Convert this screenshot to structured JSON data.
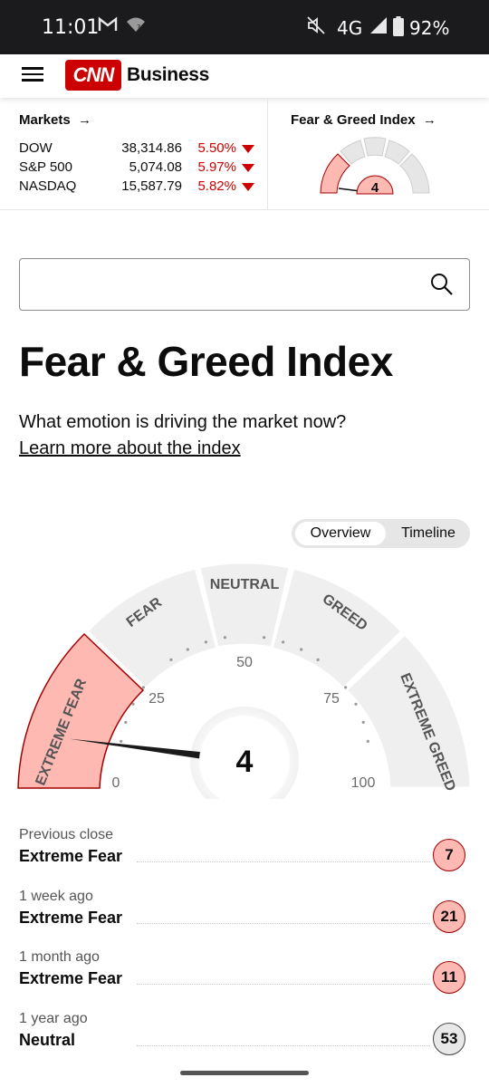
{
  "status_bar": {
    "time": "11:01",
    "network": "4G",
    "battery": "92%",
    "icons": [
      "gmail-icon",
      "wifi-question-icon",
      "mute-icon",
      "signal-icon",
      "battery-icon"
    ]
  },
  "header": {
    "logo_text": "CNN",
    "brand": "Business"
  },
  "markets": {
    "title": "Markets",
    "rows": [
      {
        "name": "DOW",
        "value": "38,314.86",
        "change": "5.50%"
      },
      {
        "name": "S&P 500",
        "value": "5,074.08",
        "change": "5.97%"
      },
      {
        "name": "NASDAQ",
        "value": "15,587.79",
        "change": "5.82%"
      }
    ],
    "change_color": "#cc0000"
  },
  "fear_greed_widget": {
    "title": "Fear & Greed Index",
    "value": "4"
  },
  "search": {
    "placeholder": "",
    "value": ""
  },
  "page": {
    "title": "Fear & Greed Index",
    "subtitle": "What emotion is driving the market now?",
    "learn_link": "Learn more about the index"
  },
  "toggle": {
    "options": [
      "Overview",
      "Timeline"
    ],
    "selected": "Overview"
  },
  "gauge": {
    "value": 4,
    "value_label": "4",
    "segments": [
      "EXTREME FEAR",
      "FEAR",
      "NEUTRAL",
      "GREED",
      "EXTREME GREED"
    ],
    "active_segment": "EXTREME FEAR",
    "ticks": [
      "0",
      "25",
      "50",
      "75",
      "100"
    ],
    "active_color": "#ffb9b3",
    "inactive_color": "#efefef"
  },
  "history": [
    {
      "when": "Previous close",
      "rating": "Extreme Fear",
      "value": "7",
      "type": "fear"
    },
    {
      "when": "1 week ago",
      "rating": "Extreme Fear",
      "value": "21",
      "type": "fear"
    },
    {
      "when": "1 month ago",
      "rating": "Extreme Fear",
      "value": "11",
      "type": "fear"
    },
    {
      "when": "1 year ago",
      "rating": "Neutral",
      "value": "53",
      "type": "neutral"
    }
  ]
}
